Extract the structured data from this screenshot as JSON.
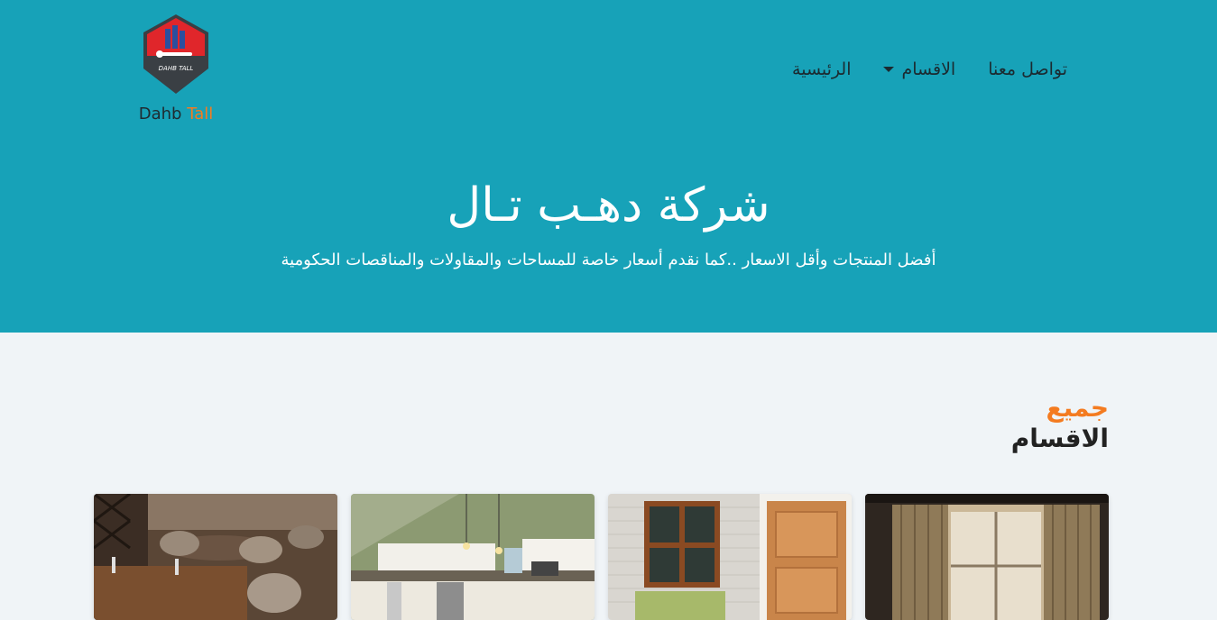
{
  "brand": {
    "name_part1": "Dahb",
    "name_part2": "Tall",
    "badge_text": "DAHB TALL"
  },
  "nav": {
    "items": [
      {
        "label": "تواصل معنا",
        "has_dropdown": false
      },
      {
        "label": "الاقسام",
        "has_dropdown": true
      },
      {
        "label": "الرئيسية",
        "has_dropdown": false
      }
    ]
  },
  "hero": {
    "title": "شركة دهـب تـال",
    "subtitle": "أفضل المنتجات وأقل الاسعار ..كما نقدم أسعار خاصة للمساحات والمقاولات والمناقصات الحكومية"
  },
  "section": {
    "title_line1": "جميع",
    "title_line2": "الاقسام"
  },
  "colors": {
    "hero_bg": "#17a2b8",
    "accent": "#f47b20",
    "page_bg": "#f0f4f7"
  }
}
